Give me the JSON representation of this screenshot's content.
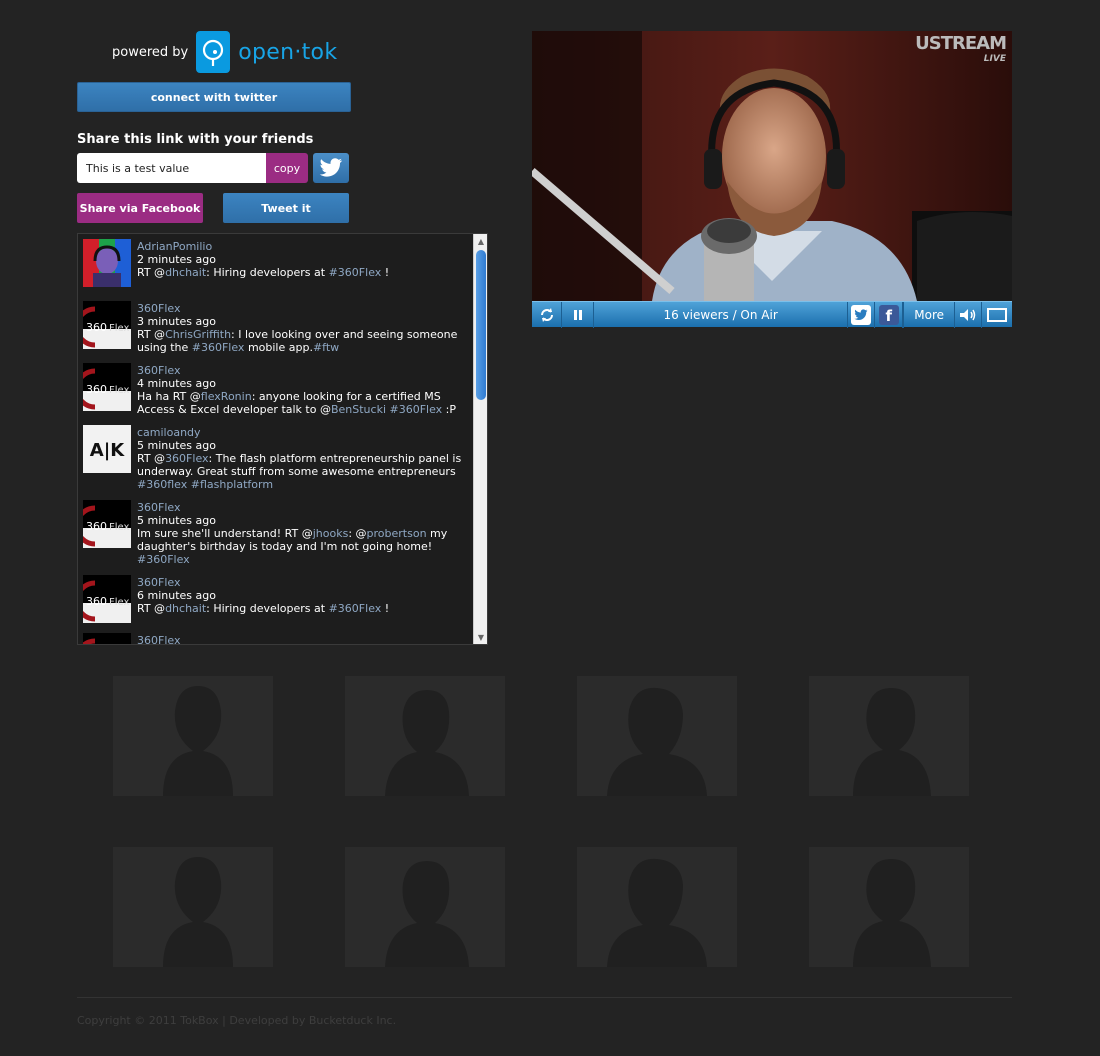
{
  "branding": {
    "powered_by": "powered by",
    "logo_word": "open·tok"
  },
  "buttons": {
    "connect_twitter": "connect with twitter",
    "copy": "copy",
    "share_facebook": "Share via Facebook",
    "tweet_it": "Tweet it"
  },
  "share": {
    "label": "Share this link with your friends",
    "link_value": "This is a test value"
  },
  "tweets": [
    {
      "user": "AdrianPomilio",
      "time": "2 minutes ago",
      "avatar": "person-photo",
      "text": [
        {
          "t": "RT @"
        },
        {
          "m": "dhchait"
        },
        {
          "t": ": Hiring developers at "
        },
        {
          "m": "#360Flex"
        },
        {
          "t": " !"
        }
      ]
    },
    {
      "user": "360Flex",
      "time": "3 minutes ago",
      "avatar": "360flex-logo",
      "text": [
        {
          "t": "RT @"
        },
        {
          "m": "ChrisGriffith"
        },
        {
          "t": ": I love looking over and seeing someone using the "
        },
        {
          "m": "#360Flex"
        },
        {
          "t": " mobile app."
        },
        {
          "m": "#ftw"
        }
      ]
    },
    {
      "user": "360Flex",
      "time": "4 minutes ago",
      "avatar": "360flex-logo",
      "text": [
        {
          "t": "Ha ha RT @"
        },
        {
          "m": "flexRonin"
        },
        {
          "t": ": anyone looking for a certified MS Access & Excel developer talk to @"
        },
        {
          "m": "BenStucki"
        },
        {
          "t": " "
        },
        {
          "m": "#360Flex"
        },
        {
          "t": " :P"
        }
      ]
    },
    {
      "user": "camiloandy",
      "time": "5 minutes ago",
      "avatar": "ak-logo",
      "text": [
        {
          "t": "RT @"
        },
        {
          "m": "360Flex"
        },
        {
          "t": ": The flash platform entrepreneurship panel is underway. Great stuff from some awesome entrepreneurs "
        },
        {
          "m": "#360flex"
        },
        {
          "t": " "
        },
        {
          "m": "#flashplatform"
        }
      ]
    },
    {
      "user": "360Flex",
      "time": "5 minutes ago",
      "avatar": "360flex-logo",
      "text": [
        {
          "t": "Im sure she'll understand! RT @"
        },
        {
          "m": "jhooks"
        },
        {
          "t": ": @"
        },
        {
          "m": "probertson"
        },
        {
          "t": " my daughter's birthday is today and I'm not going home! "
        },
        {
          "m": "#360Flex"
        }
      ]
    },
    {
      "user": "360Flex",
      "time": "6 minutes ago",
      "avatar": "360flex-logo",
      "text": [
        {
          "t": "RT @"
        },
        {
          "m": "dhchait"
        },
        {
          "t": ": Hiring developers at "
        },
        {
          "m": "#360Flex"
        },
        {
          "t": " !"
        }
      ]
    },
    {
      "user": "360Flex",
      "time": "",
      "avatar": "360flex-logo",
      "text": []
    }
  ],
  "video": {
    "brand": "USTREAM",
    "brand_sub": "LIVE",
    "viewers": "16 viewers / On Air",
    "more": "More"
  },
  "footer": {
    "copyright": "Copyright © 2011 TokBox | Developed by Bucketduck Inc."
  },
  "colors": {
    "background": "#232323",
    "accent_blue": "#2f6fa8",
    "accent_magenta": "#9b2c83",
    "link": "#8fa8c4"
  }
}
